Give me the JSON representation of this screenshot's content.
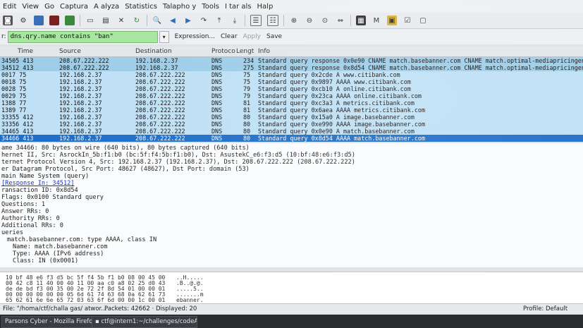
{
  "menu": [
    "Edit",
    "View",
    "Go",
    "Captura",
    "A alyza",
    "Statistics",
    "Talapho y",
    "Tools",
    "I tar als",
    "Halp"
  ],
  "filter": {
    "label": "r:",
    "value": "dns.qry.name contains \"ban\"",
    "expression": "Expression...",
    "clear": "Clear",
    "apply": "Apply",
    "save": "Save"
  },
  "columns": [
    "Time",
    "Source",
    "Destination",
    "Protoco",
    "Lengt",
    "Info"
  ],
  "packets": [
    {
      "no": "34505 413",
      "src": "208.67.222.222",
      "dst": "192.168.2.37",
      "proto": "DNS",
      "len": "234",
      "info": "Standard query response 0x0e90  CNAME match.basebanner.com  CNAME match.optimal-mediapricingengine",
      "type": "resp"
    },
    {
      "no": "34512 413",
      "src": "208.67.222.222",
      "dst": "192.168.2.37",
      "proto": "DNS",
      "len": "275",
      "info": "Standard query response 0x8d54  CNAME match.basebanner.com  CNAME match.optimal-mediapricingengine",
      "type": "resp"
    },
    {
      "no": "0017 75",
      "src": "192.168.2.37",
      "dst": "208.67.222.222",
      "proto": "DNS",
      "len": "75",
      "info": "Standard query 0x2cde  A www.citibank.com",
      "type": "qry"
    },
    {
      "no": "0018 75",
      "src": "192.168.2.37",
      "dst": "208.67.222.222",
      "proto": "DNS",
      "len": "75",
      "info": "Standard query 0x9897  AAAA www.citibank.com",
      "type": "qry"
    },
    {
      "no": "0028 75",
      "src": "192.168.2.37",
      "dst": "208.67.222.222",
      "proto": "DNS",
      "len": "79",
      "info": "Standard query 0xcb10  A online.citibank.com",
      "type": "qry"
    },
    {
      "no": "0029 75",
      "src": "192.168.2.37",
      "dst": "208.67.222.222",
      "proto": "DNS",
      "len": "79",
      "info": "Standard query 0x23ca  AAAA online.citibank.com",
      "type": "qry"
    },
    {
      "no": "1388 77",
      "src": "192.168.2.37",
      "dst": "208.67.222.222",
      "proto": "DNS",
      "len": "81",
      "info": "Standard query 0xc3a3  A metrics.citibank.com",
      "type": "qry"
    },
    {
      "no": "1389 77",
      "src": "192.168.2.37",
      "dst": "208.67.222.222",
      "proto": "DNS",
      "len": "81",
      "info": "Standard query 0x6aea  AAAA metrics.citibank.com",
      "type": "qry"
    },
    {
      "no": "33355 412",
      "src": "192.168.2.37",
      "dst": "208.67.222.222",
      "proto": "DNS",
      "len": "80",
      "info": "Standard query 0x15a0  A image.basebanner.com",
      "type": "qry"
    },
    {
      "no": "33356 412",
      "src": "192.168.2.37",
      "dst": "208.67.222.222",
      "proto": "DNS",
      "len": "80",
      "info": "Standard query 0xe990  AAAA image.basebanner.com",
      "type": "qry"
    },
    {
      "no": "34465 413",
      "src": "192.168.2.37",
      "dst": "208.67.222.222",
      "proto": "DNS",
      "len": "80",
      "info": "Standard query 0x0e90  A match.basebanner.com",
      "type": "qry"
    },
    {
      "no": "34466 413",
      "src": "192.168.2.37",
      "dst": "208.67.222.222",
      "proto": "DNS",
      "len": "80",
      "info": "Standard query 0x8d54  AAAA match.basebanner.com",
      "type": "sel"
    }
  ],
  "details": [
    {
      "text": "ame 34466: 80 bytes on wire (640 bits), 80 bytes captured (640 bits)",
      "indent": 0,
      "style": ""
    },
    {
      "text": "hernet II, Src: AsrockIn_5b:f1:b0 (bc:5f:f4:5b:f1:b0), Dst: AsustekC_e6:f3:d5 (10:bf:48:e6:f3:d5)",
      "indent": 0,
      "style": ""
    },
    {
      "text": "ternet Protocol Version 4, Src: 192.168.2.37 (192.168.2.37), Dst: 208.67.222.222 (208.67.222.222)",
      "indent": 0,
      "style": ""
    },
    {
      "text": "er Datagram Protocol, Src Port: 48627 (48627), Dst Port: domain (53)",
      "indent": 0,
      "style": ""
    },
    {
      "text": "main Name System (query)",
      "indent": 0,
      "style": ""
    },
    {
      "text": "[Response In: 34512]",
      "indent": 0,
      "style": "link"
    },
    {
      "text": "ransaction ID: 0x8d54",
      "indent": 0,
      "style": ""
    },
    {
      "text": "Flags: 0x0100 Standard query",
      "indent": 0,
      "style": ""
    },
    {
      "text": "Questions: 1",
      "indent": 0,
      "style": ""
    },
    {
      "text": "Answer RRs: 0",
      "indent": 0,
      "style": ""
    },
    {
      "text": "Authority RRs: 0",
      "indent": 0,
      "style": ""
    },
    {
      "text": "Additional RRs: 0",
      "indent": 0,
      "style": ""
    },
    {
      "text": "ueries",
      "indent": 0,
      "style": ""
    },
    {
      "text": "match.basebanner.com: type AAAA, class IN",
      "indent": 1,
      "style": ""
    },
    {
      "text": "Name: match.basebanner.com",
      "indent": 2,
      "style": ""
    },
    {
      "text": "Type: AAAA (IPv6 address)",
      "indent": 2,
      "style": ""
    },
    {
      "text": "Class: IN (0x0001)",
      "indent": 2,
      "style": ""
    }
  ],
  "hex": [
    {
      "bytes": "10 bf 48 e6 f3 d5 bc 5f  f4 5b f1 b0 08 00 45 00",
      "ascii": "..H....."
    },
    {
      "bytes": "00 42 c8 11 40 00 40 11  00 aa c0 a8 02 25 d0 43",
      "ascii": ".B..@.@."
    },
    {
      "bytes": "de de bd f3 00 35 00 2e  72 2f 8d 54 01 00 00 01",
      "ascii": ".....5.."
    },
    {
      "bytes": "00 00 00 00 00 00 05 6d  61 74 63 68 0a 62 61 73",
      "ascii": ".......m"
    },
    {
      "bytes": "65 62 61 6e 6e 65 72 03  63 6f 6d 00 00 1c 00 01",
      "ascii": "ebanner."
    }
  ],
  "status": {
    "file": "File: \"/homa/ctf/challa gas/ atwor...",
    "packets": "Packets: 42662 · Displayed: 20",
    "profile": "Profile: Default"
  },
  "taskbar": {
    "firefox": "Parsons Cyber - Mozilla Firefox",
    "terminal": "ctf@intern1:~/challenges/codeA"
  }
}
